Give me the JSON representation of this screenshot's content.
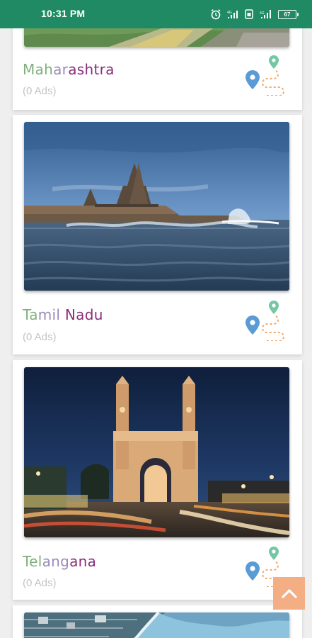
{
  "status_bar": {
    "time": "10:31 PM",
    "battery": "67"
  },
  "states": [
    {
      "name_parts": [
        {
          "text": "Mah",
          "tone": "c1"
        },
        {
          "text": "ar",
          "tone": "c2"
        },
        {
          "text": "ashtra",
          "tone": "c3"
        }
      ],
      "ads": "(0 Ads)"
    },
    {
      "name_parts": [
        {
          "text": "Ta",
          "tone": "c1"
        },
        {
          "text": "mil",
          "tone": "c2"
        },
        {
          "text": " Nadu",
          "tone": "c3"
        }
      ],
      "ads": "(0 Ads)"
    },
    {
      "name_parts": [
        {
          "text": "Tel",
          "tone": "c1"
        },
        {
          "text": "ang",
          "tone": "c2"
        },
        {
          "text": "ana",
          "tone": "c3"
        }
      ],
      "ads": "(0 Ads)"
    }
  ],
  "colors": {
    "status_bar": "#1f8a64",
    "scroll_top": "#f4ae84",
    "pin_blue": "#5b9bd5",
    "pin_green": "#74c7a4",
    "route_orange": "#f3a96a"
  },
  "icons": {
    "alarm": "alarm-icon",
    "signal": "signal-icon",
    "route": "route-map-icon",
    "scroll_top": "chevron-up-icon"
  }
}
